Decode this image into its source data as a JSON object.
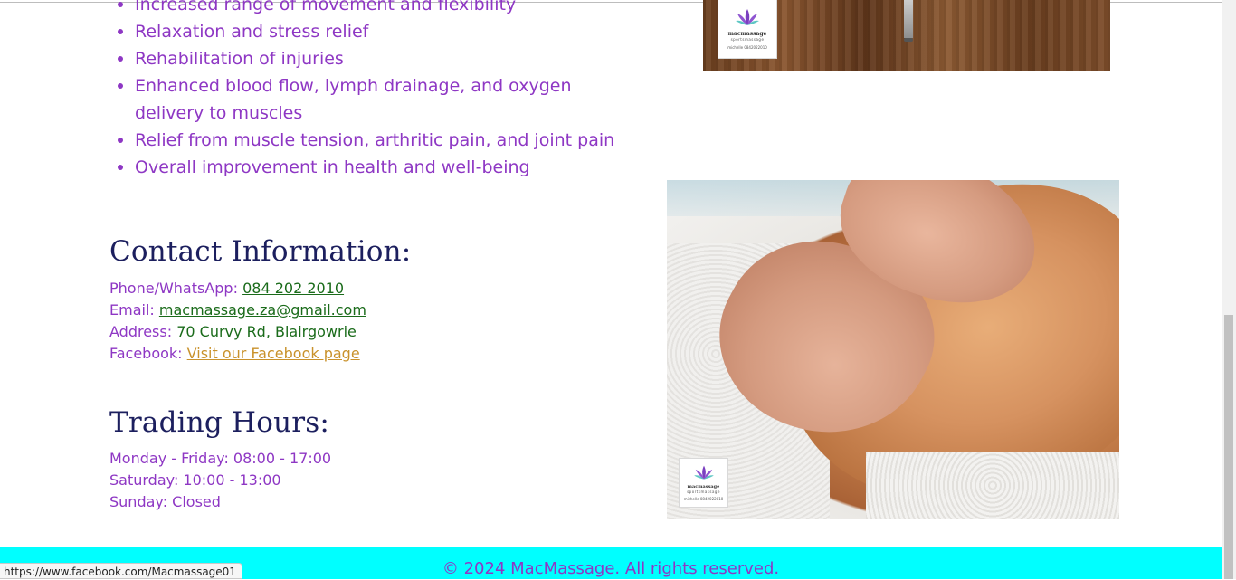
{
  "benefits": [
    "Increased range of movement and flexibility",
    "Relaxation and stress relief",
    "Rehabilitation of injuries",
    "Enhanced blood flow, lymph drainage, and oxygen delivery to muscles",
    "Relief from muscle tension, arthritic pain, and joint pain",
    "Overall improvement in health and well-being"
  ],
  "contact": {
    "heading": "Contact Information:",
    "phone_label": "Phone/WhatsApp:",
    "phone_value": "084 202 2010",
    "email_label": "Email:",
    "email_value": "macmassage.za@gmail.com",
    "address_label": "Address:",
    "address_value": "70 Curvy Rd, Blairgowrie",
    "facebook_label": "Facebook:",
    "facebook_value": "Visit our Facebook page"
  },
  "hours": {
    "heading": "Trading Hours:",
    "weekday": "Monday - Friday: 08:00 - 17:00",
    "saturday": "Saturday: 10:00 - 13:00",
    "sunday": "Sunday: Closed"
  },
  "logo": {
    "brand": "macmassage",
    "sub": "sportsmassage",
    "small": "michelle 0842022010"
  },
  "footer": {
    "text": "© 2024 MacMassage. All rights reserved."
  },
  "status_url": "https://www.facebook.com/Macmassage01",
  "colors": {
    "accent_purple": "#8e37c4",
    "heading_navy": "#1c1f5e",
    "link_green": "#1a6b1a",
    "link_gold": "#c9922c",
    "footer_bg": "#00ffff"
  }
}
